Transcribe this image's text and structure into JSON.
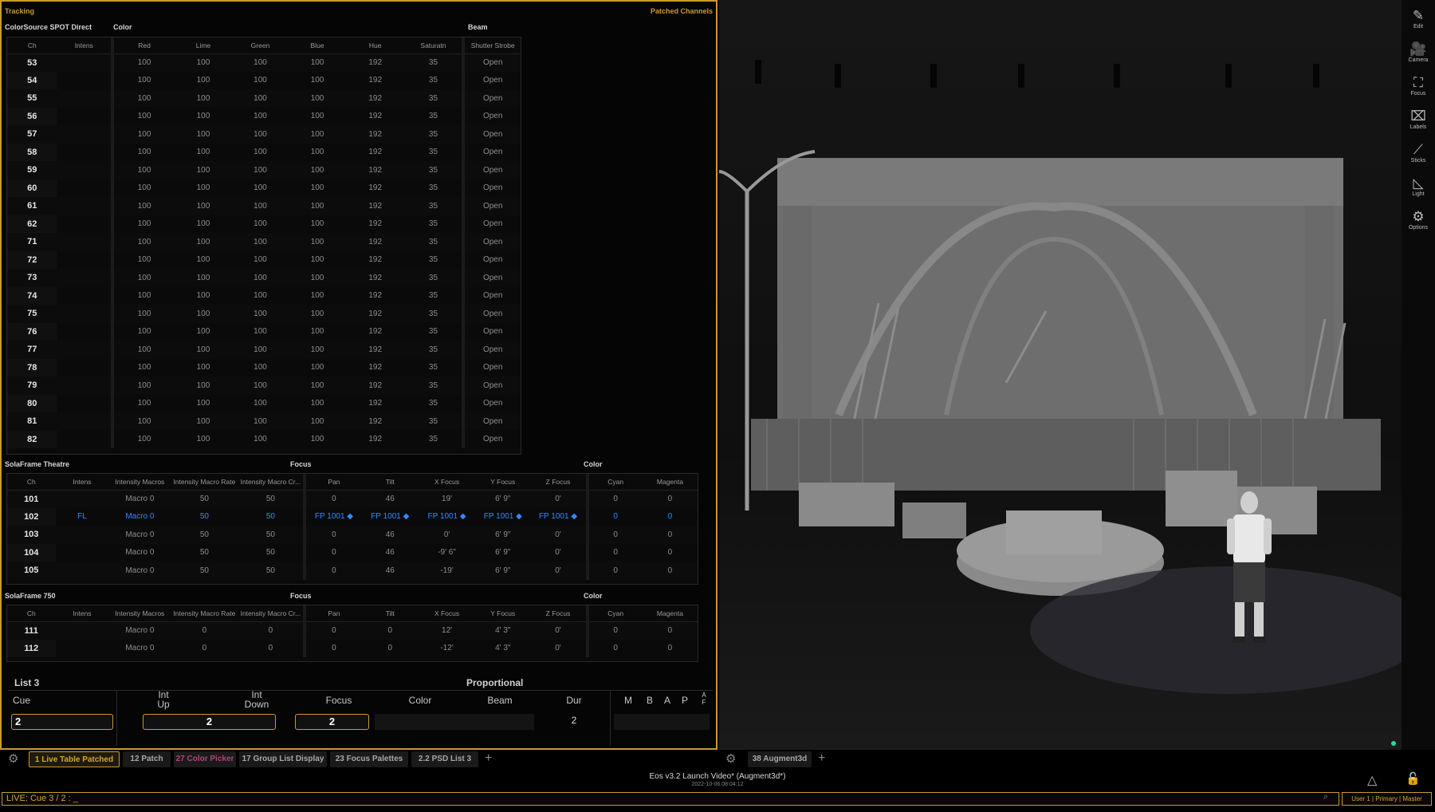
{
  "left_panel": {
    "title": "Tracking",
    "right_label": "Patched Channels",
    "grid1": {
      "fixture_label": "ColorSource SPOT Direct",
      "group_color": "Color",
      "group_beam": "Beam",
      "headers": [
        "Ch",
        "Intens",
        "Red",
        "Lime",
        "Green",
        "Blue",
        "Hue",
        "Saturatn",
        "Shutter Strobe"
      ],
      "rows": [
        [
          "53",
          "",
          "100",
          "100",
          "100",
          "100",
          "192",
          "35",
          "Open"
        ],
        [
          "54",
          "",
          "100",
          "100",
          "100",
          "100",
          "192",
          "35",
          "Open"
        ],
        [
          "55",
          "",
          "100",
          "100",
          "100",
          "100",
          "192",
          "35",
          "Open"
        ],
        [
          "56",
          "",
          "100",
          "100",
          "100",
          "100",
          "192",
          "35",
          "Open"
        ],
        [
          "57",
          "",
          "100",
          "100",
          "100",
          "100",
          "192",
          "35",
          "Open"
        ],
        [
          "58",
          "",
          "100",
          "100",
          "100",
          "100",
          "192",
          "35",
          "Open"
        ],
        [
          "59",
          "",
          "100",
          "100",
          "100",
          "100",
          "192",
          "35",
          "Open"
        ],
        [
          "60",
          "",
          "100",
          "100",
          "100",
          "100",
          "192",
          "35",
          "Open"
        ],
        [
          "61",
          "",
          "100",
          "100",
          "100",
          "100",
          "192",
          "35",
          "Open"
        ],
        [
          "62",
          "",
          "100",
          "100",
          "100",
          "100",
          "192",
          "35",
          "Open"
        ],
        [
          "71",
          "",
          "100",
          "100",
          "100",
          "100",
          "192",
          "35",
          "Open"
        ],
        [
          "72",
          "",
          "100",
          "100",
          "100",
          "100",
          "192",
          "35",
          "Open"
        ],
        [
          "73",
          "",
          "100",
          "100",
          "100",
          "100",
          "192",
          "35",
          "Open"
        ],
        [
          "74",
          "",
          "100",
          "100",
          "100",
          "100",
          "192",
          "35",
          "Open"
        ],
        [
          "75",
          "",
          "100",
          "100",
          "100",
          "100",
          "192",
          "35",
          "Open"
        ],
        [
          "76",
          "",
          "100",
          "100",
          "100",
          "100",
          "192",
          "35",
          "Open"
        ],
        [
          "77",
          "",
          "100",
          "100",
          "100",
          "100",
          "192",
          "35",
          "Open"
        ],
        [
          "78",
          "",
          "100",
          "100",
          "100",
          "100",
          "192",
          "35",
          "Open"
        ],
        [
          "79",
          "",
          "100",
          "100",
          "100",
          "100",
          "192",
          "35",
          "Open"
        ],
        [
          "80",
          "",
          "100",
          "100",
          "100",
          "100",
          "192",
          "35",
          "Open"
        ],
        [
          "81",
          "",
          "100",
          "100",
          "100",
          "100",
          "192",
          "35",
          "Open"
        ],
        [
          "82",
          "",
          "100",
          "100",
          "100",
          "100",
          "192",
          "35",
          "Open"
        ]
      ]
    },
    "grid2": {
      "fixture_label": "SolaFrame Theatre",
      "group_focus": "Focus",
      "group_color": "Color",
      "headers": [
        "Ch",
        "Intens",
        "Intensity Macros",
        "Intensity Macro Rate",
        "Intensity Macro Cr...",
        "Pan",
        "Tilt",
        "X Focus",
        "Y Focus",
        "Z Focus",
        "Cyan",
        "Magenta"
      ],
      "rows": [
        [
          "101",
          "",
          "Macro 0",
          "50",
          "50",
          "0",
          "46",
          "19'",
          "6' 9\"",
          "0'",
          "0",
          "0"
        ],
        [
          "102",
          "FL",
          "Macro 0",
          "50",
          "50",
          "FP 1001 ◆",
          "FP 1001 ◆",
          "FP 1001 ◆",
          "FP 1001 ◆",
          "FP 1001 ◆",
          "0",
          "0"
        ],
        [
          "103",
          "",
          "Macro 0",
          "50",
          "50",
          "0",
          "46",
          "0'",
          "6' 9\"",
          "0'",
          "0",
          "0"
        ],
        [
          "104",
          "",
          "Macro 0",
          "50",
          "50",
          "0",
          "46",
          "-9' 6\"",
          "6' 9\"",
          "0'",
          "0",
          "0"
        ],
        [
          "105",
          "",
          "Macro 0",
          "50",
          "50",
          "0",
          "46",
          "-19'",
          "6' 9\"",
          "0'",
          "0",
          "0"
        ]
      ]
    },
    "grid3": {
      "fixture_label": "SolaFrame 750",
      "group_focus": "Focus",
      "group_color": "Color",
      "headers": [
        "Ch",
        "Intens",
        "Intensity Macros",
        "Intensity Macro Rate",
        "Intensity Macro Cr...",
        "Pan",
        "Tilt",
        "X Focus",
        "Y Focus",
        "Z Focus",
        "Cyan",
        "Magenta"
      ],
      "rows": [
        [
          "111",
          "",
          "Macro 0",
          "0",
          "0",
          "0",
          "0",
          "12'",
          "4' 3\"",
          "0'",
          "0",
          "0"
        ],
        [
          "112",
          "",
          "Macro 0",
          "0",
          "0",
          "0",
          "0",
          "-12'",
          "4' 3\"",
          "0'",
          "0",
          "0"
        ]
      ]
    }
  },
  "cue_list": {
    "title": "List 3",
    "mode": "Proportional",
    "columns": {
      "cue": "Cue",
      "int_up": "Int\nUp",
      "int_down": "Int\nDown",
      "focus": "Focus",
      "color": "Color",
      "beam": "Beam",
      "dur": "Dur",
      "m": "M",
      "b": "B",
      "a": "A",
      "p": "P",
      "af": "A\nF"
    },
    "values": {
      "cue": "2",
      "int_up": "2",
      "focus": "2",
      "dur": "2"
    }
  },
  "tabs_left": [
    {
      "label": "1 Live Table Patched",
      "active": true
    },
    {
      "label": "12 Patch"
    },
    {
      "label": "27 Color Picker",
      "pink": true
    },
    {
      "label": "17 Group List Display"
    },
    {
      "label": "23 Focus Palettes"
    },
    {
      "label": "2.2 PSD List 3"
    }
  ],
  "tabs_right": [
    {
      "label": "38 Augment3d"
    }
  ],
  "plus": "+",
  "footer": {
    "title": "Eos v3.2 Launch Video* (Augment3d*)",
    "date": "2022-10-06 08:04:12"
  },
  "command_line": "LIVE: Cue  3 / 2 : _",
  "status": "User 1 | Primary | Master",
  "sidebar": [
    {
      "label": "Edit",
      "icon": "pencil-icon",
      "glyph": "✎"
    },
    {
      "label": "Camera",
      "icon": "camera-icon",
      "glyph": "🎥"
    },
    {
      "label": "Focus",
      "icon": "focus-icon",
      "glyph": "⛶"
    },
    {
      "label": "Labels",
      "icon": "label-icon",
      "glyph": "⌧"
    },
    {
      "label": "Sticks",
      "icon": "sticks-icon",
      "glyph": "⟋"
    },
    {
      "label": "Light",
      "icon": "light-icon",
      "glyph": "◺"
    },
    {
      "label": "Options",
      "icon": "gear-icon",
      "glyph": "⚙"
    }
  ],
  "colors": {
    "accent": "#c89b2e",
    "selection": "#2f8cff",
    "magenta_tab": "#b0457a"
  }
}
